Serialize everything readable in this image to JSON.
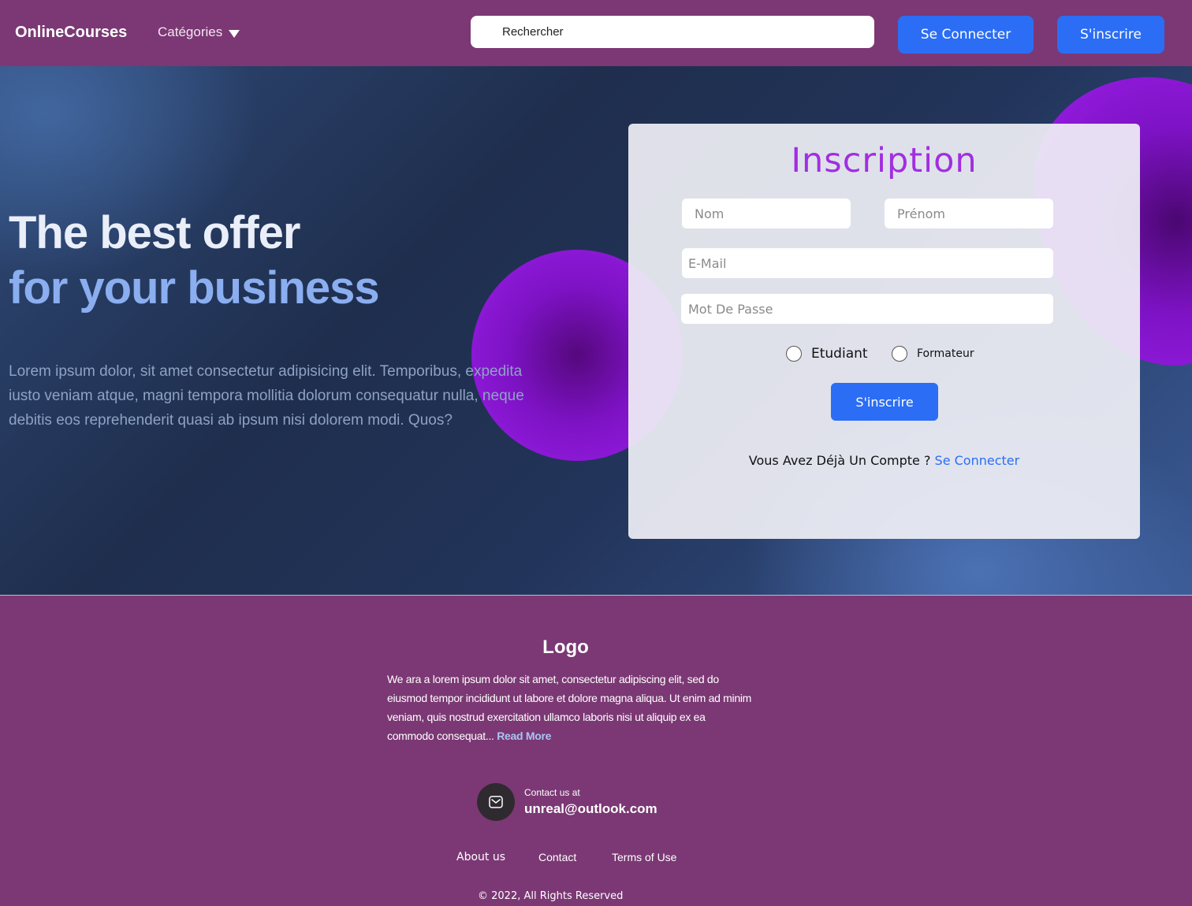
{
  "header": {
    "brand": "OnlineCourses",
    "categories_label": "Catégories",
    "search_placeholder": "Rechercher",
    "login_label": "Se Connecter",
    "signup_label": "S'inscrire"
  },
  "hero": {
    "headline_line1": "The best offer",
    "headline_line2": "for your business",
    "description": "Lorem ipsum dolor, sit amet consectetur adipisicing elit. Temporibus, expedita iusto veniam atque, magni tempora mollitia dolorum consequatur nulla, neque debitis eos reprehenderit quasi ab ipsum nisi dolorem modi. Quos?"
  },
  "form": {
    "title": "Inscription",
    "nom_placeholder": "Nom",
    "prenom_placeholder": "Prénom",
    "email_placeholder": "E-Mail",
    "password_placeholder": "Mot De Passe",
    "role_student": "Etudiant",
    "role_trainer": "Formateur",
    "submit_label": "S'inscrire",
    "have_account_text": "Vous Avez Déjà Un Compte ? ",
    "login_link": "Se Connecter"
  },
  "footer": {
    "logo": "Logo",
    "about_text": "We ara a lorem ipsum dolor sit amet, consectetur adipiscing elit, sed do eiusmod tempor incididunt ut labore et dolore magna aliqua. Ut enim ad minim veniam, quis nostrud exercitation ullamco laboris nisi ut aliquip ex ea commodo consequat... ",
    "read_more": "Read More",
    "contact_label": "Contact us at",
    "contact_email": "unreal@outlook.com",
    "links": [
      "About us",
      "Contact",
      "Terms of Use"
    ],
    "copyright": "© 2022, All Rights Reserved"
  },
  "colors": {
    "primary_purple": "#7b3874",
    "button_blue": "#2b6ef5",
    "title_violet": "#a12ee0",
    "headline_blue": "#8aaef0"
  },
  "icons": {
    "categories": "chevron-down-icon",
    "contact": "mail-icon"
  }
}
